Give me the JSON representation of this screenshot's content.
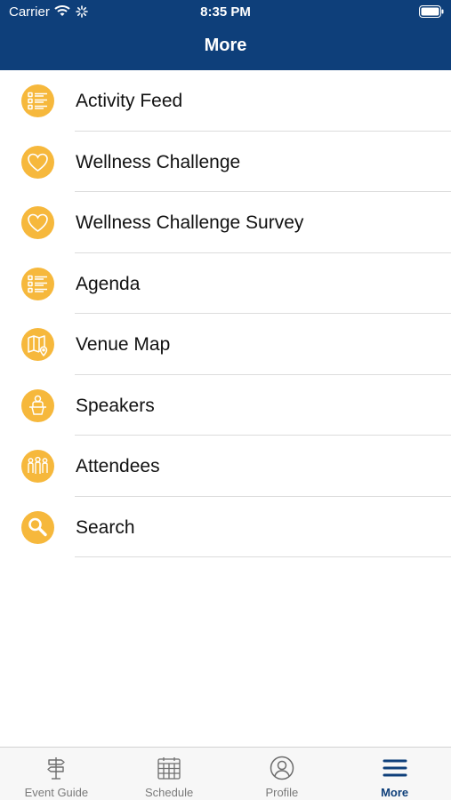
{
  "status_bar": {
    "carrier": "Carrier",
    "time": "8:35 PM"
  },
  "nav": {
    "title": "More"
  },
  "menu": {
    "items": [
      {
        "label": "Activity Feed",
        "icon": "list-icon"
      },
      {
        "label": "Wellness Challenge",
        "icon": "heart-icon"
      },
      {
        "label": "Wellness Challenge Survey",
        "icon": "heart-icon"
      },
      {
        "label": "Agenda",
        "icon": "list-icon"
      },
      {
        "label": "Venue Map",
        "icon": "map-icon"
      },
      {
        "label": "Speakers",
        "icon": "speaker-podium-icon"
      },
      {
        "label": "Attendees",
        "icon": "people-icon"
      },
      {
        "label": "Search",
        "icon": "search-icon"
      }
    ]
  },
  "tab_bar": {
    "tabs": [
      {
        "label": "Event Guide",
        "icon": "signpost-icon",
        "active": false
      },
      {
        "label": "Schedule",
        "icon": "calendar-icon",
        "active": false
      },
      {
        "label": "Profile",
        "icon": "profile-icon",
        "active": false
      },
      {
        "label": "More",
        "icon": "hamburger-menu-icon",
        "active": true
      }
    ]
  },
  "colors": {
    "header": "#0e3f7a",
    "icon_background": "#f6b83c",
    "active_tab": "#0e3f7a",
    "inactive_tab": "#7a7a7a"
  }
}
